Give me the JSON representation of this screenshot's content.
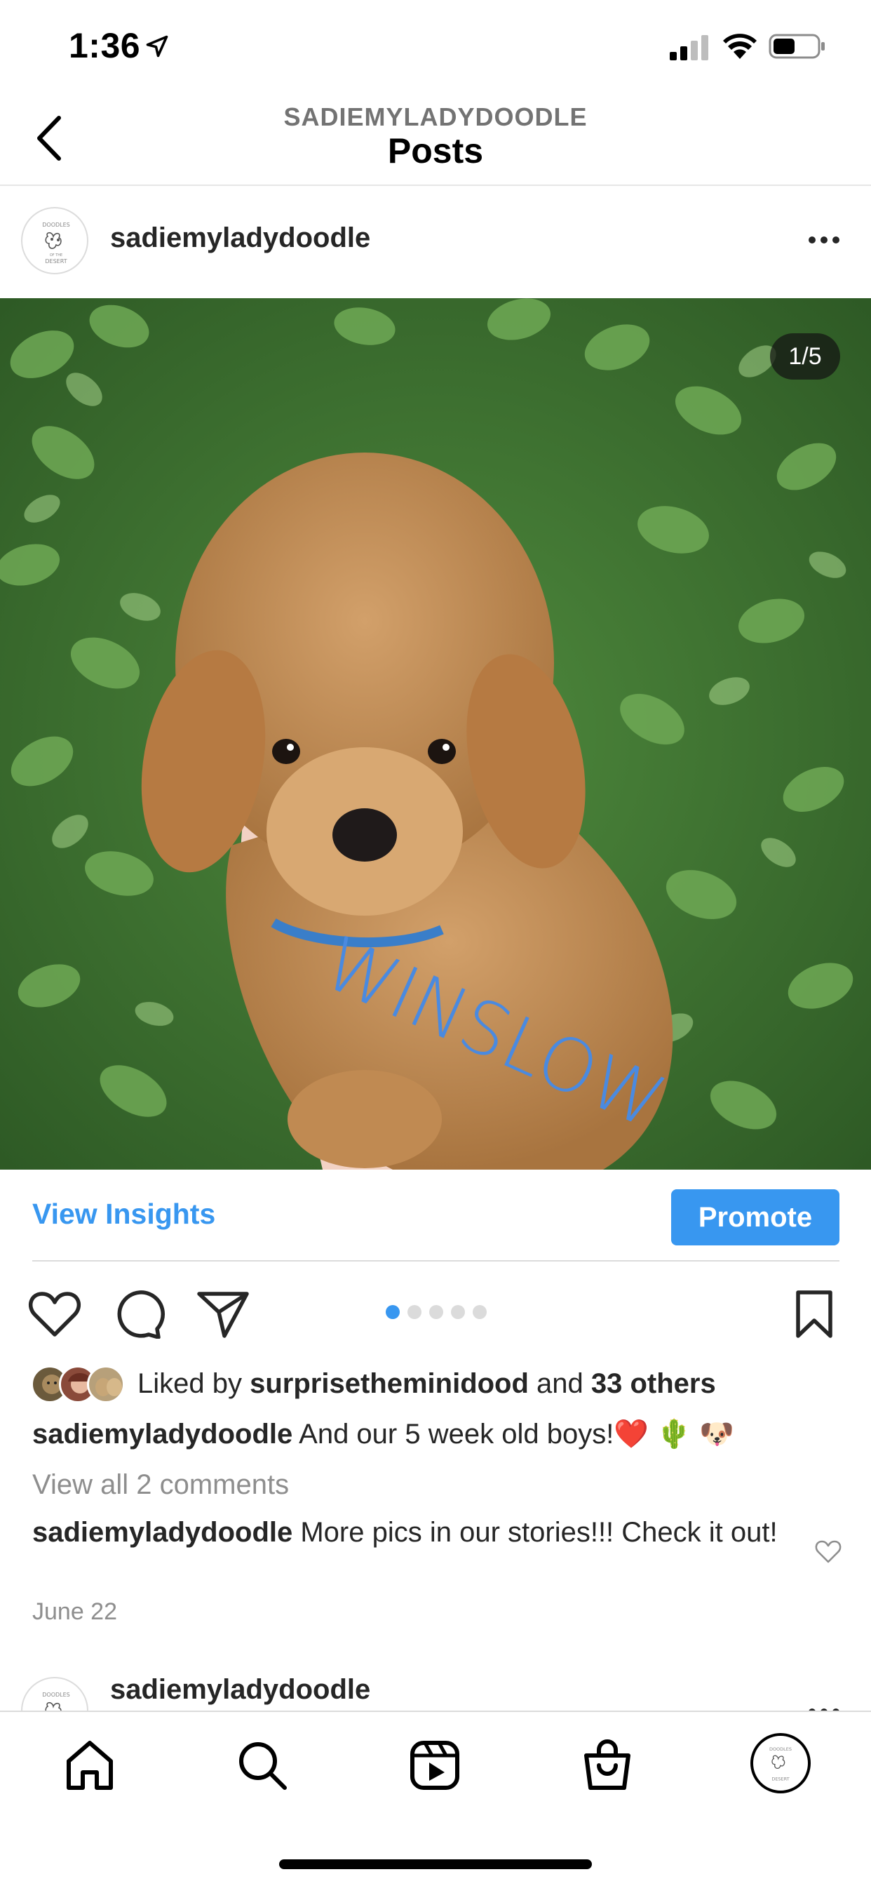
{
  "status_bar": {
    "time": "1:36",
    "icons": [
      "location-arrow-icon",
      "cellular-signal-icon",
      "wifi-icon",
      "battery-icon"
    ]
  },
  "header": {
    "subtitle": "SADIEMYLADYDOODLE",
    "title": "Posts",
    "back_icon": "chevron-left-icon"
  },
  "post": {
    "username": "sadiemyladydoodle",
    "avatar_logo_text": [
      "DOODLES",
      "OF THE",
      "DESERT"
    ],
    "more_icon": "ellipsis-icon",
    "photo_counter": "1/5",
    "photo_overlay_text": "WINSLOW",
    "carousel": {
      "total": 5,
      "active": 1
    },
    "insights_label": "View Insights",
    "promote_label": "Promote",
    "likes": {
      "prefix": "Liked by ",
      "user": "surprisetheminidood",
      "middle": " and ",
      "others": "33 others"
    },
    "caption": {
      "user": "sadiemyladydoodle",
      "text": " And our 5 week old boys!❤️ 🌵 🐶"
    },
    "view_comments": "View all 2 comments",
    "comment": {
      "user": "sadiemyladydoodle",
      "text": " More pics in our stories!!! Check it out!"
    },
    "date": "June 22"
  },
  "next_post": {
    "username": "sadiemyladydoodle"
  },
  "tab_bar": {
    "items": [
      "home-icon",
      "search-icon",
      "reels-icon",
      "shop-icon",
      "profile-avatar"
    ]
  },
  "colors": {
    "accent": "#3897f0",
    "text": "#262626",
    "muted": "#8e8e8e",
    "divider": "#dbdbdb"
  }
}
